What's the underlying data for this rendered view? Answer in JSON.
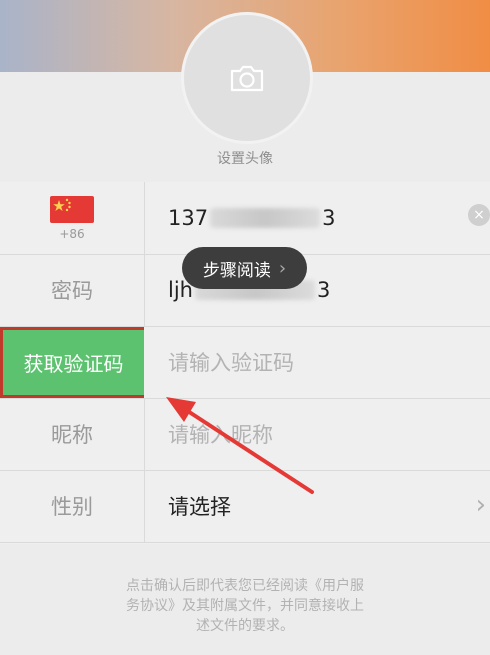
{
  "header": {
    "avatar_caption": "设置头像",
    "colors": {
      "banner_start": "#a9b4c9",
      "banner_end": "#f08d45"
    }
  },
  "form": {
    "country_code": "+86",
    "phone_prefix": "137",
    "phone_suffix": "3",
    "password_label": "密码",
    "password_prefix": "ljh",
    "password_suffix": "3",
    "get_code_button": "获取验证码",
    "code_placeholder": "请输入验证码",
    "nickname_label": "昵称",
    "nickname_placeholder": "请输入昵称",
    "gender_label": "性别",
    "gender_value": "请选择"
  },
  "toast": {
    "label": "步骤阅读",
    "icon": "chevron-right-icon"
  },
  "agreement": {
    "line1": "点击确认后即代表您已经阅读《用户服",
    "line2": "务协议》及其附属文件，并同意接收上",
    "line3": "述文件的要求。"
  },
  "icons": {
    "avatar": "camera-icon",
    "flag": "china-flag-icon",
    "clear": "clear-icon",
    "select": "chevron-right-icon",
    "annotation": "red-arrow-icon"
  },
  "colors": {
    "accent": "#5cc26f",
    "highlight_border": "#c0392b",
    "arrow": "#e53935"
  }
}
